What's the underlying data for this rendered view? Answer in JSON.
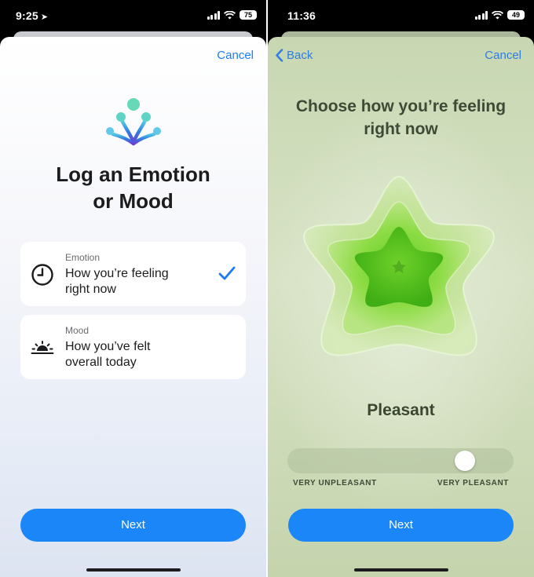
{
  "left": {
    "status": {
      "time": "9:25",
      "battery": "75"
    },
    "nav": {
      "cancel": "Cancel"
    },
    "title_line1": "Log an Emotion",
    "title_line2": "or Mood",
    "options": [
      {
        "label": "Emotion",
        "text_line1": "How you’re feeling",
        "text_line2": "right now",
        "selected": true
      },
      {
        "label": "Mood",
        "text_line1": "How you’ve felt",
        "text_line2": "overall today",
        "selected": false
      }
    ],
    "next": "Next"
  },
  "right": {
    "status": {
      "time": "11:36",
      "battery": "49"
    },
    "nav": {
      "back": "Back",
      "cancel": "Cancel"
    },
    "title_line1": "Choose how you’re feeling",
    "title_line2": "right now",
    "valence": "Pleasant",
    "slider": {
      "min_label": "VERY UNPLEASANT",
      "max_label": "VERY PLEASANT",
      "value_fraction": 0.82
    },
    "next": "Next"
  },
  "colors": {
    "accent": "#1a86f8",
    "green_core": "#6fd12a",
    "sheet_green": "#cfdcbb"
  },
  "icons": [
    "location-arrow-icon",
    "signal-icon",
    "wifi-icon",
    "battery-icon",
    "state-of-mind-icon",
    "clock-icon",
    "sunset-icon",
    "checkmark-icon",
    "chevron-left-icon"
  ]
}
